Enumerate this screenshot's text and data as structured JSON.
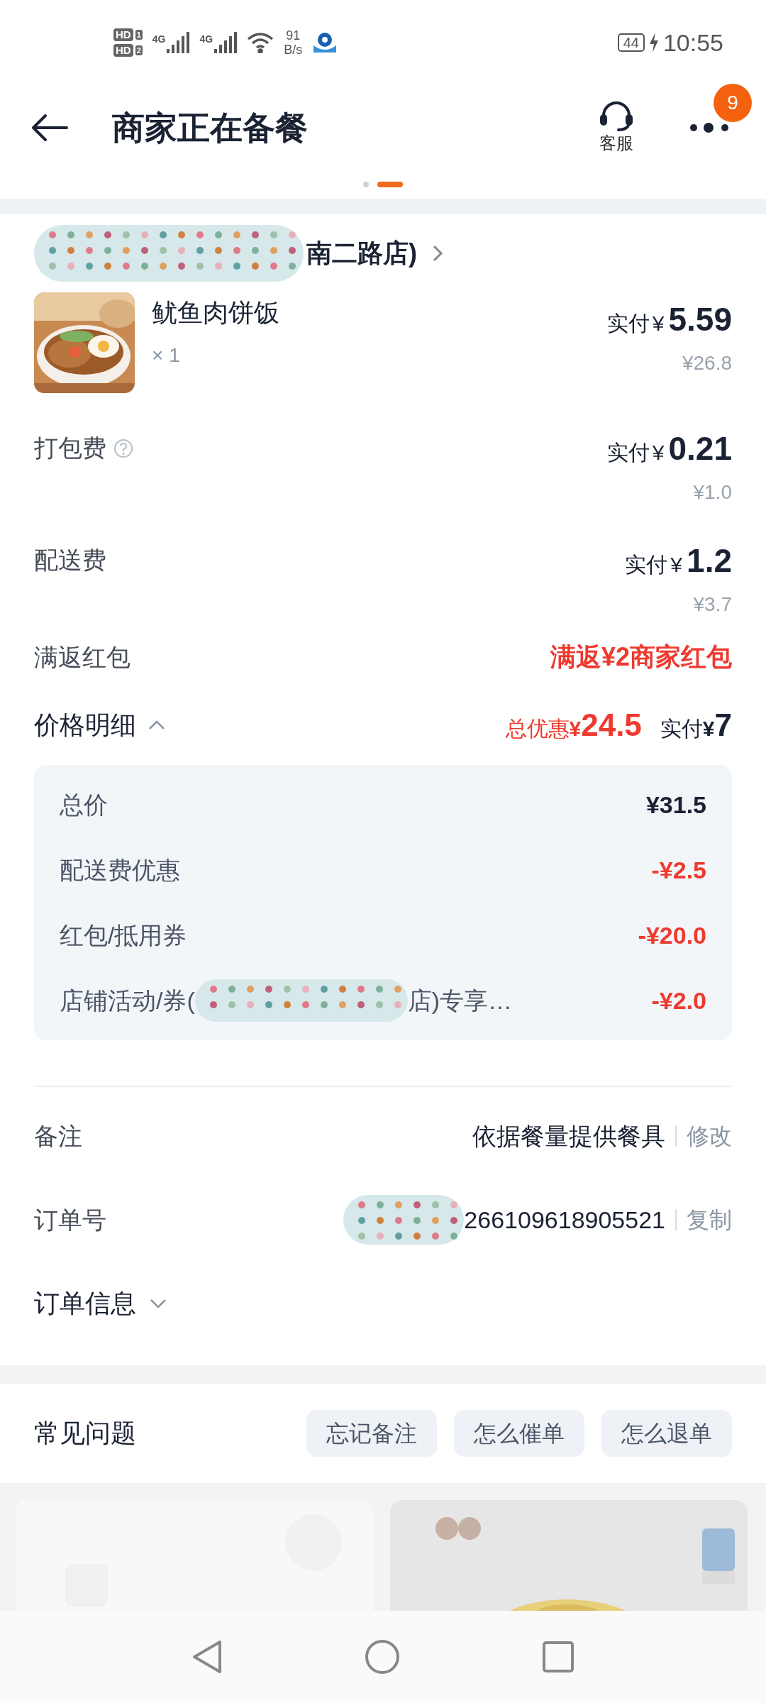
{
  "status_bar": {
    "sims": [
      {
        "hd": "HD",
        "slot": "1",
        "network": "4G"
      },
      {
        "hd": "HD",
        "slot": "2",
        "network": "4G"
      }
    ],
    "speed": "91",
    "speed_unit": "B/s",
    "battery": "44",
    "time": "10:55"
  },
  "header": {
    "title": "商家正在备餐",
    "service_label": "客服",
    "more_badge": "9"
  },
  "page_dots": [
    {
      "selected": false
    },
    {
      "selected": true
    }
  ],
  "store": {
    "name": "南二路店)",
    "redacted": true
  },
  "items": [
    {
      "name": "鱿鱼肉饼饭",
      "quantity": "× 1",
      "paid_label": "实付",
      "currency": "¥",
      "paid": "5.59",
      "original": "¥26.8"
    }
  ],
  "fees": [
    {
      "label": "打包费",
      "help": true,
      "paid_label": "实付",
      "currency": "¥",
      "paid": "0.21",
      "original": "¥1.0"
    },
    {
      "label": "配送费",
      "help": false,
      "paid_label": "实付",
      "currency": "¥",
      "paid": "1.2",
      "original": "¥3.7"
    }
  ],
  "red_packet": {
    "label": "满返红包",
    "value": "满返¥2商家红包"
  },
  "price_detail": {
    "label": "价格明细",
    "expanded": true,
    "discount_label": "总优惠",
    "discount_currency": "¥",
    "discount": "24.5",
    "paid_label": "实付",
    "paid_currency": "¥",
    "paid": "7"
  },
  "breakdown": [
    {
      "label": "总价",
      "value": "¥31.5",
      "kind": "total"
    },
    {
      "label": "配送费优惠",
      "value": "-¥2.5",
      "kind": "discount"
    },
    {
      "label": "红包/抵用券",
      "value": "-¥20.0",
      "kind": "discount"
    },
    {
      "label": "店铺活动/券(",
      "label_end": "店)专享…",
      "redacted": true,
      "value": "-¥2.0",
      "kind": "discount"
    }
  ],
  "remark": {
    "label": "备注",
    "value": "依据餐量提供餐具",
    "action": "修改"
  },
  "order_number": {
    "label": "订单号",
    "value": "266109618905521",
    "action": "复制",
    "redacted": true
  },
  "order_info": {
    "label": "订单信息",
    "expanded": false
  },
  "faq": {
    "title": "常见问题",
    "chips": [
      "忘记备注",
      "怎么催单",
      "怎么退单"
    ]
  }
}
